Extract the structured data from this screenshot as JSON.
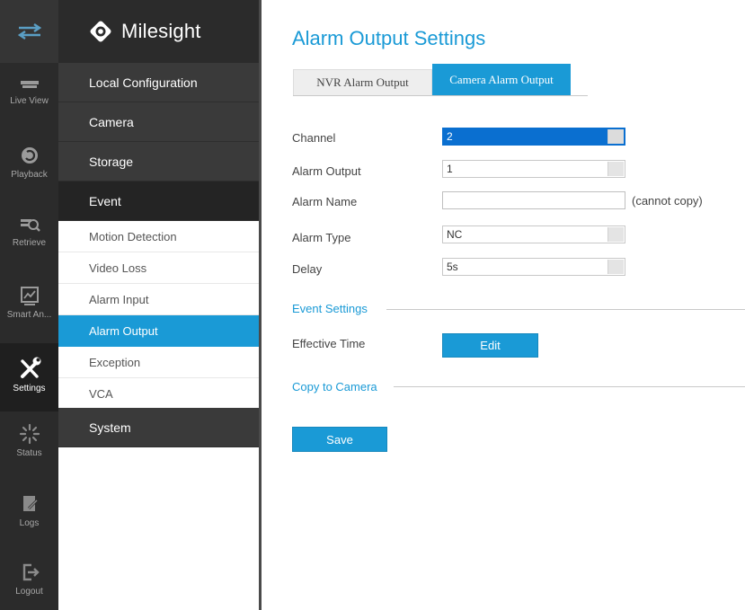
{
  "brand": {
    "name": "Milesight"
  },
  "rail": [
    {
      "id": "top",
      "label": ""
    },
    {
      "id": "live-view",
      "label": "Live View"
    },
    {
      "id": "playback",
      "label": "Playback"
    },
    {
      "id": "retrieve",
      "label": "Retrieve"
    },
    {
      "id": "smart-analysis",
      "label": "Smart An..."
    },
    {
      "id": "settings",
      "label": "Settings",
      "active": true
    },
    {
      "id": "status",
      "label": "Status"
    },
    {
      "id": "logs",
      "label": "Logs"
    },
    {
      "id": "logout",
      "label": "Logout"
    }
  ],
  "menu": {
    "local_configuration": "Local Configuration",
    "camera": "Camera",
    "storage": "Storage",
    "event": "Event",
    "event_items": [
      "Motion Detection",
      "Video Loss",
      "Alarm Input",
      "Alarm Output",
      "Exception",
      "VCA"
    ],
    "active_item": "Alarm Output",
    "system": "System"
  },
  "page": {
    "title": "Alarm Output Settings",
    "tabs": [
      "NVR Alarm Output",
      "Camera Alarm Output"
    ],
    "active_tab": "Camera Alarm Output"
  },
  "form": {
    "channel_label": "Channel",
    "channel_value": "2",
    "alarm_output_label": "Alarm Output",
    "alarm_output_value": "1",
    "alarm_name_label": "Alarm Name",
    "alarm_name_value": "",
    "alarm_name_hint": "(cannot copy)",
    "alarm_type_label": "Alarm Type",
    "alarm_type_value": "NC",
    "delay_label": "Delay",
    "delay_value": "5s"
  },
  "event_settings": {
    "title": "Event Settings",
    "effective_time_label": "Effective Time",
    "edit_button": "Edit"
  },
  "copy_to_camera": {
    "title": "Copy to Camera"
  },
  "save_button": "Save",
  "colors": {
    "accent": "#1a9ad6",
    "sidebar_dark": "#2b2b2b",
    "selected_field": "#0a6fd0"
  }
}
